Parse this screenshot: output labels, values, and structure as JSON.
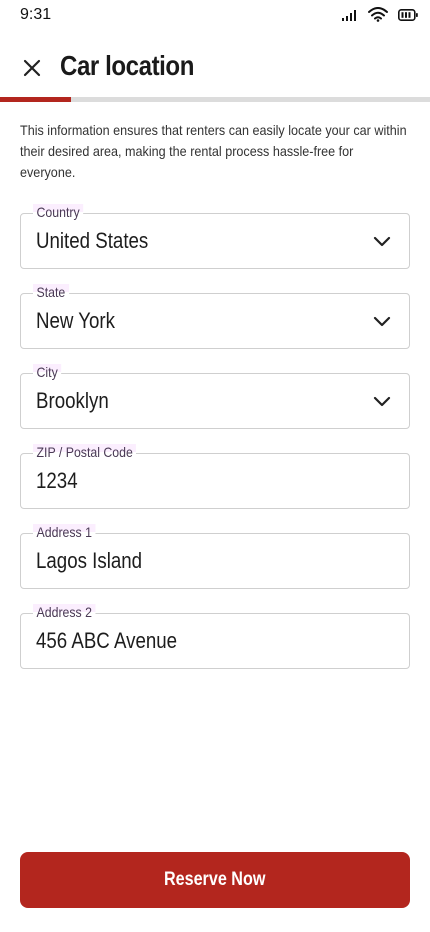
{
  "status_bar": {
    "time": "9:31"
  },
  "header": {
    "title": "Car location",
    "close_icon": "close-icon"
  },
  "progress": {
    "fraction": 0.165,
    "fill_color": "#b3261e",
    "track_color": "#dcdcdc"
  },
  "description": "This information ensures that renters can easily locate your car within their desired area, making the rental process hassle-free for everyone.",
  "form": {
    "country": {
      "label": "Country",
      "value": "United States"
    },
    "state": {
      "label": "State",
      "value": "New York"
    },
    "city": {
      "label": "City",
      "value": "Brooklyn"
    },
    "zip": {
      "label": "ZIP / Postal Code",
      "value": "1234"
    },
    "address1": {
      "label": "Address 1",
      "value": "Lagos Island"
    },
    "address2": {
      "label": "Address 2",
      "value": "456 ABC Avenue"
    }
  },
  "action": {
    "reserve_label": "Reserve Now",
    "color": "#b3261e"
  }
}
